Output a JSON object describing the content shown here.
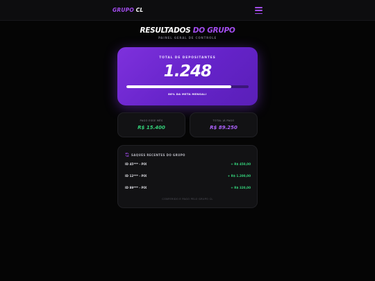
{
  "header": {
    "logo_part1": "GRUPO",
    "logo_part2": "CL",
    "menu_icon": "hamburger-menu-icon"
  },
  "page": {
    "title_part1": "RESULTADOS",
    "title_part2": "DO GRUPO",
    "subtitle": "PAINEL GERAL DE CONTROLE"
  },
  "hero": {
    "label": "TOTAL DE DEPOSITANTES",
    "value": "1.248",
    "progress_percent": 86,
    "caption": "86% DA META MENSAL!"
  },
  "stats": {
    "monthly_label": "PAGO ESSE MÊS",
    "monthly_value": "R$ 15.400",
    "total_label": "TOTAL JÁ PAGO",
    "total_value": "R$ 89.250"
  },
  "withdrawals": {
    "title": "SAQUES RECENTES DO GRUPO",
    "icon": "refresh-icon",
    "rows": [
      {
        "id": "ID 45*** - PIX",
        "amount": "+ R$ 450,00"
      },
      {
        "id": "ID 12*** - PIX",
        "amount": "+ R$ 1.200,00"
      },
      {
        "id": "ID 89*** - PIX",
        "amount": "+ R$ 320,00"
      }
    ],
    "footer": "CONFERIDO E PAGO PELO GRUPO CL"
  },
  "colors": {
    "accent": "#a44df0",
    "success": "#34d17a",
    "background": "#050505"
  }
}
